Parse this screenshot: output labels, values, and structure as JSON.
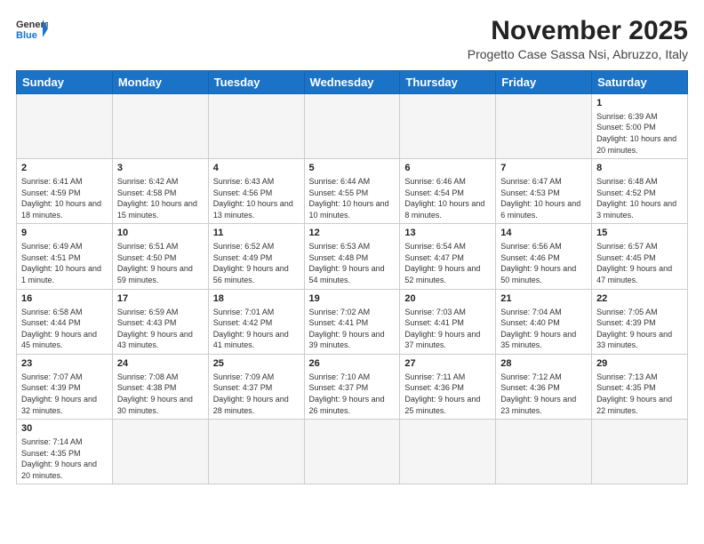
{
  "logo": {
    "general": "General",
    "blue": "Blue"
  },
  "header": {
    "title": "November 2025",
    "subtitle": "Progetto Case Sassa Nsi, Abruzzo, Italy"
  },
  "days_of_week": [
    "Sunday",
    "Monday",
    "Tuesday",
    "Wednesday",
    "Thursday",
    "Friday",
    "Saturday"
  ],
  "weeks": [
    [
      {
        "day": "",
        "info": ""
      },
      {
        "day": "",
        "info": ""
      },
      {
        "day": "",
        "info": ""
      },
      {
        "day": "",
        "info": ""
      },
      {
        "day": "",
        "info": ""
      },
      {
        "day": "",
        "info": ""
      },
      {
        "day": "1",
        "info": "Sunrise: 6:39 AM\nSunset: 5:00 PM\nDaylight: 10 hours and 20 minutes."
      }
    ],
    [
      {
        "day": "2",
        "info": "Sunrise: 6:41 AM\nSunset: 4:59 PM\nDaylight: 10 hours and 18 minutes."
      },
      {
        "day": "3",
        "info": "Sunrise: 6:42 AM\nSunset: 4:58 PM\nDaylight: 10 hours and 15 minutes."
      },
      {
        "day": "4",
        "info": "Sunrise: 6:43 AM\nSunset: 4:56 PM\nDaylight: 10 hours and 13 minutes."
      },
      {
        "day": "5",
        "info": "Sunrise: 6:44 AM\nSunset: 4:55 PM\nDaylight: 10 hours and 10 minutes."
      },
      {
        "day": "6",
        "info": "Sunrise: 6:46 AM\nSunset: 4:54 PM\nDaylight: 10 hours and 8 minutes."
      },
      {
        "day": "7",
        "info": "Sunrise: 6:47 AM\nSunset: 4:53 PM\nDaylight: 10 hours and 6 minutes."
      },
      {
        "day": "8",
        "info": "Sunrise: 6:48 AM\nSunset: 4:52 PM\nDaylight: 10 hours and 3 minutes."
      }
    ],
    [
      {
        "day": "9",
        "info": "Sunrise: 6:49 AM\nSunset: 4:51 PM\nDaylight: 10 hours and 1 minute."
      },
      {
        "day": "10",
        "info": "Sunrise: 6:51 AM\nSunset: 4:50 PM\nDaylight: 9 hours and 59 minutes."
      },
      {
        "day": "11",
        "info": "Sunrise: 6:52 AM\nSunset: 4:49 PM\nDaylight: 9 hours and 56 minutes."
      },
      {
        "day": "12",
        "info": "Sunrise: 6:53 AM\nSunset: 4:48 PM\nDaylight: 9 hours and 54 minutes."
      },
      {
        "day": "13",
        "info": "Sunrise: 6:54 AM\nSunset: 4:47 PM\nDaylight: 9 hours and 52 minutes."
      },
      {
        "day": "14",
        "info": "Sunrise: 6:56 AM\nSunset: 4:46 PM\nDaylight: 9 hours and 50 minutes."
      },
      {
        "day": "15",
        "info": "Sunrise: 6:57 AM\nSunset: 4:45 PM\nDaylight: 9 hours and 47 minutes."
      }
    ],
    [
      {
        "day": "16",
        "info": "Sunrise: 6:58 AM\nSunset: 4:44 PM\nDaylight: 9 hours and 45 minutes."
      },
      {
        "day": "17",
        "info": "Sunrise: 6:59 AM\nSunset: 4:43 PM\nDaylight: 9 hours and 43 minutes."
      },
      {
        "day": "18",
        "info": "Sunrise: 7:01 AM\nSunset: 4:42 PM\nDaylight: 9 hours and 41 minutes."
      },
      {
        "day": "19",
        "info": "Sunrise: 7:02 AM\nSunset: 4:41 PM\nDaylight: 9 hours and 39 minutes."
      },
      {
        "day": "20",
        "info": "Sunrise: 7:03 AM\nSunset: 4:41 PM\nDaylight: 9 hours and 37 minutes."
      },
      {
        "day": "21",
        "info": "Sunrise: 7:04 AM\nSunset: 4:40 PM\nDaylight: 9 hours and 35 minutes."
      },
      {
        "day": "22",
        "info": "Sunrise: 7:05 AM\nSunset: 4:39 PM\nDaylight: 9 hours and 33 minutes."
      }
    ],
    [
      {
        "day": "23",
        "info": "Sunrise: 7:07 AM\nSunset: 4:39 PM\nDaylight: 9 hours and 32 minutes."
      },
      {
        "day": "24",
        "info": "Sunrise: 7:08 AM\nSunset: 4:38 PM\nDaylight: 9 hours and 30 minutes."
      },
      {
        "day": "25",
        "info": "Sunrise: 7:09 AM\nSunset: 4:37 PM\nDaylight: 9 hours and 28 minutes."
      },
      {
        "day": "26",
        "info": "Sunrise: 7:10 AM\nSunset: 4:37 PM\nDaylight: 9 hours and 26 minutes."
      },
      {
        "day": "27",
        "info": "Sunrise: 7:11 AM\nSunset: 4:36 PM\nDaylight: 9 hours and 25 minutes."
      },
      {
        "day": "28",
        "info": "Sunrise: 7:12 AM\nSunset: 4:36 PM\nDaylight: 9 hours and 23 minutes."
      },
      {
        "day": "29",
        "info": "Sunrise: 7:13 AM\nSunset: 4:35 PM\nDaylight: 9 hours and 22 minutes."
      }
    ],
    [
      {
        "day": "30",
        "info": "Sunrise: 7:14 AM\nSunset: 4:35 PM\nDaylight: 9 hours and 20 minutes."
      },
      {
        "day": "",
        "info": ""
      },
      {
        "day": "",
        "info": ""
      },
      {
        "day": "",
        "info": ""
      },
      {
        "day": "",
        "info": ""
      },
      {
        "day": "",
        "info": ""
      },
      {
        "day": "",
        "info": ""
      }
    ]
  ]
}
